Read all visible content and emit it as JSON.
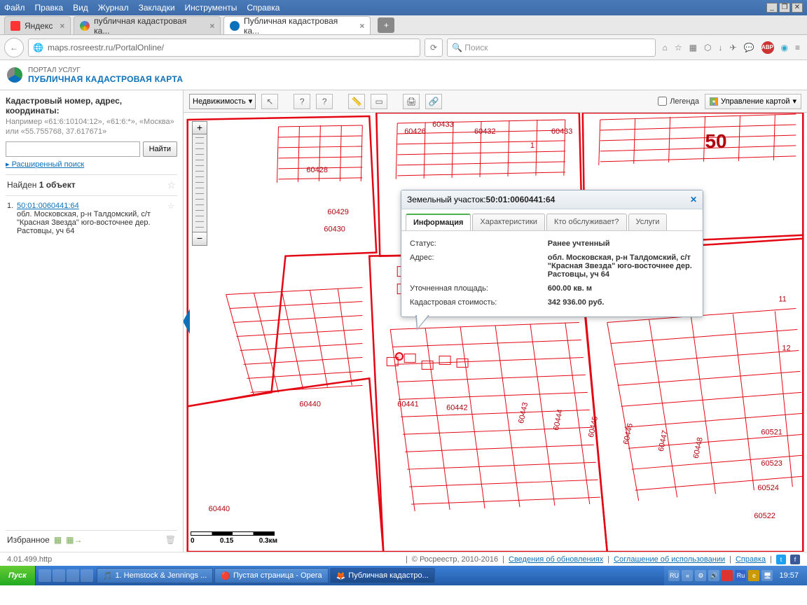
{
  "menu": {
    "file": "Файл",
    "edit": "Правка",
    "view": "Вид",
    "history": "Журнал",
    "bookmarks": "Закладки",
    "tools": "Инструменты",
    "help": "Справка"
  },
  "tabs": {
    "t1": "Яндекс",
    "t2": "публичная кадастровая ка...",
    "t3": "Публичная кадастровая ка..."
  },
  "url": "maps.rosreestr.ru/PortalOnline/",
  "search_placeholder": "Поиск",
  "portal": {
    "small": "ПОРТАЛ УСЛУГ",
    "big": "ПУБЛИЧНАЯ КАДАСТРОВАЯ КАРТА"
  },
  "sidebar": {
    "title": "Кадастровый номер, адрес, координаты:",
    "hint": "Например «61:6:10104:12», «61:6:*», «Москва» или «55.755768, 37.617671»",
    "find": "Найти",
    "adv": "Расширенный поиск",
    "found_pre": "Найден ",
    "found_b": "1 объект",
    "res_num": "1.",
    "res_link": "50:01:0060441:64",
    "res_addr": "обл. Московская, р-н Талдомский, с/т \"Красная Звезда\" юго-восточнее дер. Растовцы, уч 64",
    "fav": "Избранное"
  },
  "toolbar": {
    "select": "Недвижимость",
    "legend": "Легенда",
    "mapctrl": "Управление картой"
  },
  "popup": {
    "title_pre": "Земельный участок: ",
    "title_id": "50:01:0060441:64",
    "tab_info": "Информация",
    "tab_char": "Характеристики",
    "tab_who": "Кто обслуживает?",
    "tab_srv": "Услуги",
    "row_status_l": "Статус:",
    "row_status_v": "Ранее учтенный",
    "row_addr_l": "Адрес:",
    "row_addr_v": "обл. Московская, р-н Талдомский, с/т \"Красная Звезда\" юго-восточнее дер. Растовцы, уч 64",
    "row_area_l": "Уточненная площадь:",
    "row_area_v": "600.00 кв. м",
    "row_cost_l": "Кадастровая стоимость:",
    "row_cost_v": "342 936.00 руб."
  },
  "map_labels": {
    "big50": "50",
    "l60426": "60426",
    "l60428": "60428",
    "l60429": "60429",
    "l60430": "60430",
    "l60432": "60432",
    "l60433": "60433",
    "l60433b": "60433",
    "l1": "1",
    "l60440": "60440",
    "l60440b": "60440",
    "l60441": "60441",
    "l60442": "60442",
    "l60443": "60443",
    "l60444": "60444",
    "l60445": "60445",
    "l60446": "60446",
    "l60447": "60447",
    "l60448": "60448",
    "l60521": "60521",
    "l60522": "60522",
    "l60523": "60523",
    "l60524": "60524",
    "l11": "11",
    "l12": "12",
    "s0": "0",
    "s015": "0.15",
    "s03": "0.3км"
  },
  "footer": {
    "ver": "4.01.499.http",
    "copy": "© Росреестр, 2010-2016",
    "upd": "Сведения об обновлениях",
    "agree": "Соглашение об использовании",
    "help": "Справка"
  },
  "taskbar": {
    "start": "Пуск",
    "t1": "1. Hemstock & Jennings ...",
    "t2": "Пустая страница - Opera",
    "t3": "Публичная кадастро...",
    "time": "19:57",
    "ru": "RU"
  }
}
